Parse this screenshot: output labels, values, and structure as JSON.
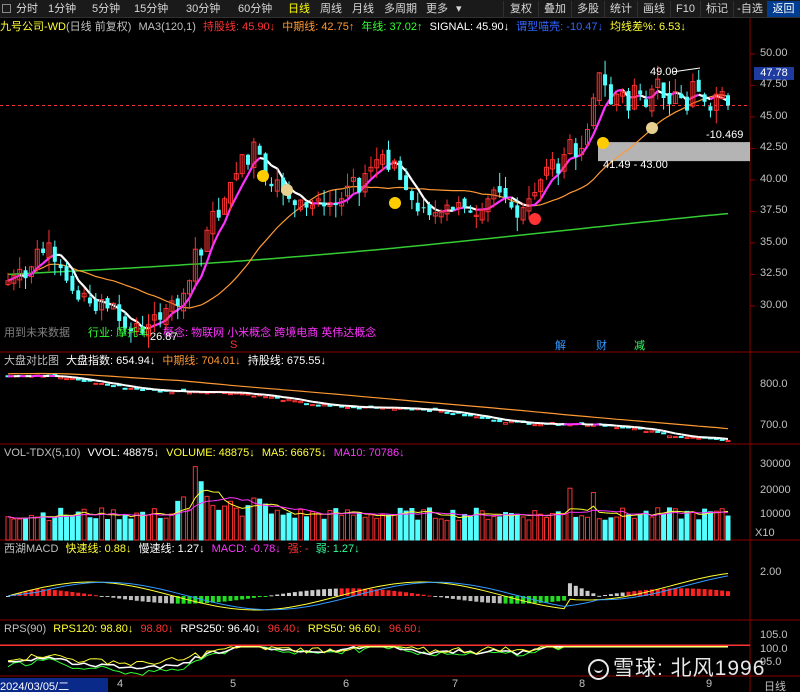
{
  "toolbar": {
    "periods": [
      "分时",
      "1分钟",
      "5分钟",
      "15分钟",
      "30分钟",
      "60分钟",
      "日线",
      "周线",
      "月线",
      "多周期",
      "更多"
    ],
    "active_period": "日线",
    "right_buttons": [
      "复权",
      "叠加",
      "多股",
      "统计",
      "画线",
      "F10",
      "标记",
      "-自选"
    ],
    "back": "返回"
  },
  "main_panel": {
    "title": "九号公司-WD",
    "subtitle": "(日线 前复权)",
    "items": [
      {
        "text": "MA3(120,1)",
        "color": "#c0c0c0"
      },
      {
        "text": "持股线: 45.90↓",
        "color": "#ff3333"
      },
      {
        "text": "中期线: 42.75↑",
        "color": "#ff9933"
      },
      {
        "text": "年线: 37.02↑",
        "color": "#33ff33"
      },
      {
        "text": "SIGNAL: 45.90↓",
        "color": "#ffffff"
      },
      {
        "text": "谓型喵壳: -10.47↓",
        "color": "#3366ff"
      },
      {
        "text": "均线差%: 6.53↓",
        "color": "#ffff33"
      }
    ],
    "high_marker": "49.00",
    "price_tag": "47.78",
    "signal_label": "-10.469",
    "zone_label": "41.49 - 43.00",
    "low_marker": "26.87",
    "future_text": "用到未来数据",
    "industry": "行业: 摩托车",
    "concepts": "概念: 物联网 小米概念 跨境电商 英伟达概念",
    "event_marks": [
      "解",
      "财",
      "减"
    ],
    "s_mark": "S"
  },
  "index_panel": {
    "title": "大盘对比图",
    "items": [
      {
        "text": "大盘指数: 654.94↓",
        "color": "#ffffff"
      },
      {
        "text": "中期线: 704.01↓",
        "color": "#ff9933"
      },
      {
        "text": "持股线: 675.55↓",
        "color": "#ffffff"
      }
    ],
    "ticks": [
      "800.0",
      "700.0"
    ]
  },
  "vol_panel": {
    "title": "VOL-TDX(5,10)",
    "items": [
      {
        "text": "VVOL: 48875↓",
        "color": "#ffffff"
      },
      {
        "text": "VOLUME: 48875↓",
        "color": "#ffff33"
      },
      {
        "text": "MA5: 66675↓",
        "color": "#ffff33"
      },
      {
        "text": "MA10: 70786↓",
        "color": "#ff33ff"
      }
    ],
    "ticks": [
      "30000",
      "20000",
      "10000"
    ],
    "unit": "X10"
  },
  "macd_panel": {
    "title": "西湖MACD",
    "items": [
      {
        "text": "快速线: 0.88↓",
        "color": "#ffff33"
      },
      {
        "text": "慢速线: 1.27↓",
        "color": "#ffffff"
      },
      {
        "text": "MACD: -0.78↓",
        "color": "#ff33ff"
      },
      {
        "text": "强: -",
        "color": "#ff3333"
      },
      {
        "text": "弱: 1.27↓",
        "color": "#33ff99"
      }
    ],
    "ticks": [
      "2.00"
    ]
  },
  "rps_panel": {
    "title": "RPS(90)",
    "items": [
      {
        "text": "RPS120: 98.80↓",
        "color": "#ffff33"
      },
      {
        "text": "98.80↓",
        "color": "#ff3333"
      },
      {
        "text": "RPS250: 96.40↓",
        "color": "#ffffff"
      },
      {
        "text": "96.40↓",
        "color": "#ff3333"
      },
      {
        "text": "RPS50: 96.60↓",
        "color": "#ffff33"
      },
      {
        "text": "96.60↓",
        "color": "#ff3333"
      }
    ],
    "ticks": [
      "105.0",
      "100.0",
      "95.0"
    ]
  },
  "date_axis": {
    "first": "2024/03/05/二",
    "months": [
      "4",
      "5",
      "6",
      "7",
      "8",
      "9"
    ],
    "period": "日线"
  },
  "watermark": "雪球: 北风1996",
  "colors": {
    "up": "#ff3232",
    "down": "#54ffff",
    "ma_hold": "#ffffff",
    "ma_mid": "#ff9933",
    "ma_year": "#33cc33",
    "ma_signal": "#ff33ff",
    "zone": "#c8c8c8"
  },
  "chart_data": [
    {
      "type": "candlestick",
      "title": "九号公司-WD (日线 前复权)",
      "ylim": [
        26.5,
        51.5
      ],
      "y_ticks": [
        30.0,
        32.5,
        35.0,
        37.5,
        40.0,
        42.5,
        45.0,
        47.5,
        50.0
      ],
      "x_months": [
        "2024/03/05",
        "4",
        "5",
        "6",
        "7",
        "8",
        "9"
      ],
      "close": [
        32.0,
        32.4,
        32.9,
        32.2,
        33.1,
        34.5,
        34.2,
        35.0,
        33.5,
        33.0,
        32.0,
        31.2,
        30.5,
        31.0,
        30.2,
        29.6,
        30.5,
        29.8,
        30.2,
        28.8,
        28.2,
        28.0,
        28.6,
        27.8,
        28.5,
        29.3,
        28.9,
        29.8,
        30.4,
        30.0,
        31.0,
        32.0,
        34.5,
        34.0,
        36.0,
        37.5,
        37.0,
        38.5,
        39.8,
        40.5,
        42.0,
        41.2,
        43.0,
        42.0,
        40.0,
        39.5,
        40.0,
        39.0,
        38.5,
        38.0,
        38.4,
        37.8,
        38.0,
        38.5,
        37.9,
        38.2,
        38.0,
        38.5,
        39.5,
        40.2,
        39.0,
        40.5,
        41.0,
        41.6,
        42.0,
        40.8,
        41.5,
        40.0,
        39.2,
        38.4,
        37.5,
        37.8,
        37.2,
        37.4,
        37.5,
        38.0,
        37.6,
        38.2,
        37.8,
        37.4,
        37.2,
        37.6,
        38.5,
        39.2,
        39.0,
        38.6,
        37.8,
        37.0,
        37.8,
        38.5,
        39.0,
        40.0,
        41.0,
        41.6,
        40.5,
        42.0,
        43.2,
        41.8,
        42.5,
        44.0,
        46.5,
        48.5,
        47.5,
        46.0,
        46.8,
        47.0,
        45.5,
        47.5,
        46.8,
        45.8,
        47.2,
        48.0,
        46.5,
        46.0,
        47.0,
        46.5,
        45.5,
        47.8,
        47.0,
        46.2,
        45.5,
        46.8,
        47.0,
        45.9
      ],
      "series_ma": [
        {
          "name": "持股线",
          "last": 45.9
        },
        {
          "name": "中期线",
          "last": 42.75
        },
        {
          "name": "年线",
          "last": 37.02
        }
      ],
      "zone": [
        41.49,
        43.0
      ],
      "annotations": [
        "49.00",
        "26.87",
        "-10.469",
        "47.78"
      ]
    },
    {
      "type": "line",
      "title": "大盘对比图",
      "ylim": [
        640,
        830
      ],
      "y_ticks": [
        800.0,
        700.0
      ],
      "series": [
        {
          "name": "大盘指数",
          "last": 654.94
        },
        {
          "name": "中期线",
          "last": 704.01
        },
        {
          "name": "持股线",
          "last": 675.55
        }
      ]
    },
    {
      "type": "bar",
      "title": "VOL-TDX(5,10)",
      "unit": "X10",
      "ylim": [
        0,
        38000
      ],
      "y_ticks": [
        30000,
        20000,
        10000
      ],
      "series": [
        {
          "name": "VOLUME",
          "last": 48875
        },
        {
          "name": "MA5",
          "last": 66675
        },
        {
          "name": "MA10",
          "last": 70786
        }
      ]
    },
    {
      "type": "bar",
      "title": "西湖MACD",
      "y_ticks": [
        2.0
      ],
      "series": [
        {
          "name": "快速线",
          "last": 0.88
        },
        {
          "name": "慢速线",
          "last": 1.27
        },
        {
          "name": "MACD",
          "last": -0.78
        }
      ]
    },
    {
      "type": "line",
      "title": "RPS(90)",
      "ylim": [
        80,
        108
      ],
      "y_ticks": [
        105.0,
        100.0,
        95.0
      ],
      "series": [
        {
          "name": "RPS120",
          "last": 98.8
        },
        {
          "name": "RPS250",
          "last": 96.4
        },
        {
          "name": "RPS50",
          "last": 96.6
        }
      ]
    }
  ]
}
